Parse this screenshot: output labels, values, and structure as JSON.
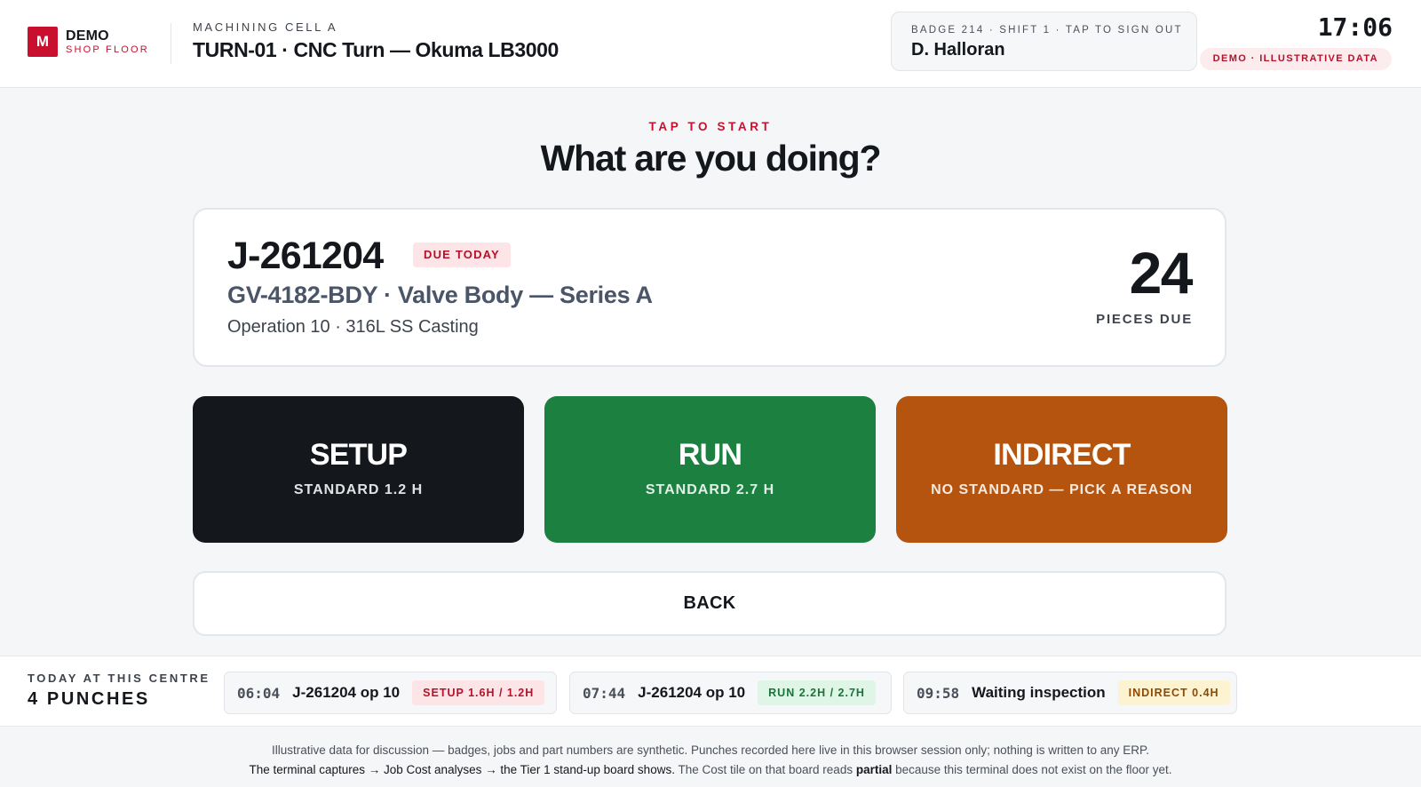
{
  "header": {
    "logo_letter": "M",
    "logo_title": "DEMO",
    "logo_subtitle": "SHOP FLOOR",
    "cell_label": "MACHINING CELL A",
    "machine_title": "TURN-01 · CNC Turn — Okuma LB3000",
    "badge_meta": "BADGE 214 · SHIFT 1 · TAP TO SIGN OUT",
    "operator_name": "D. Halloran",
    "clock": "17:06",
    "demo_pill": "DEMO · ILLUSTRATIVE DATA"
  },
  "main": {
    "eyebrow": "TAP TO START",
    "question": "What are you doing?",
    "job": {
      "number": "J-261204",
      "due_badge": "DUE TODAY",
      "part": "GV-4182-BDY · Valve Body — Series A",
      "operation": "Operation 10 · 316L SS Casting",
      "quantity": "24",
      "quantity_label": "PIECES DUE"
    },
    "actions": [
      {
        "title": "SETUP",
        "subtitle": "STANDARD 1.2 H",
        "color": "#14171c"
      },
      {
        "title": "RUN",
        "subtitle": "STANDARD 2.7 H",
        "color": "#1b8040"
      },
      {
        "title": "INDIRECT",
        "subtitle": "NO STANDARD — PICK A REASON",
        "color": "#b5540f"
      }
    ],
    "back_label": "BACK"
  },
  "today": {
    "label": "TODAY AT THIS CENTRE",
    "count": "4 PUNCHES",
    "punches": [
      {
        "time": "06:04",
        "desc": "J-261204 op 10",
        "tag": "SETUP 1.6H / 1.2H",
        "kind": "setup"
      },
      {
        "time": "07:44",
        "desc": "J-261204 op 10",
        "tag": "RUN 2.2H / 2.7H",
        "kind": "run"
      },
      {
        "time": "09:58",
        "desc": "Waiting inspection",
        "tag": "INDIRECT 0.4H",
        "kind": "indirect"
      }
    ]
  },
  "footer": {
    "line1": "Illustrative data for discussion — badges, jobs and part numbers are synthetic. Punches recorded here live in this browser session only; nothing is written to any ERP.",
    "line2_a": "The terminal captures → Job Cost analyses → the Tier 1 stand-up board shows.",
    "line2_b": " The Cost tile on that board reads ",
    "line2_bold": "partial",
    "line2_c": " because this terminal does not exist on the floor yet."
  },
  "colors": {
    "brand_red": "#c8102e",
    "setup": "#14171c",
    "run": "#1b8040",
    "indirect": "#b5540f"
  }
}
